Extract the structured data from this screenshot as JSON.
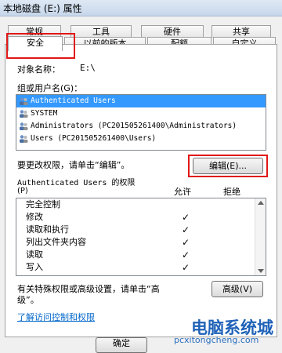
{
  "window": {
    "title": "本地磁盘 (E:) 属性"
  },
  "tabs_row1": [
    "常规",
    "工具",
    "硬件",
    "共享"
  ],
  "tabs_row2": [
    "安全",
    "以前的版本",
    "配额",
    "自定义"
  ],
  "object": {
    "label": "对象名称：",
    "value": "E:\\"
  },
  "group_list": {
    "label": "组或用户名(G)：",
    "items": [
      {
        "name": "Authenticated Users",
        "selected": true
      },
      {
        "name": "SYSTEM",
        "selected": false
      },
      {
        "name": "Administrators (PC201505261400\\Administrators)",
        "selected": false
      },
      {
        "name": "Users (PC201505261400\\Users)",
        "selected": false
      }
    ]
  },
  "edit": {
    "prompt": "要更改权限，请单击“编辑”。",
    "button": "编辑(E)..."
  },
  "permissions": {
    "title": "Authenticated Users 的权限",
    "title_key": "(P)",
    "allow_header": "允许",
    "deny_header": "拒绝",
    "rows": [
      {
        "name": "完全控制",
        "allow": ""
      },
      {
        "name": "修改",
        "allow": "✓"
      },
      {
        "name": "读取和执行",
        "allow": "✓"
      },
      {
        "name": "列出文件夹内容",
        "allow": "✓"
      },
      {
        "name": "读取",
        "allow": "✓"
      },
      {
        "name": "写入",
        "allow": "✓"
      }
    ]
  },
  "advanced": {
    "line1": "有关特殊权限或高级设置，请单击“高",
    "line2": "级”。",
    "button": "高级(V)"
  },
  "learn_link": "了解访问控制和权限",
  "footer": {
    "ok_button": "确定"
  },
  "watermark": {
    "title": "电脑系统城",
    "url": "pcxitongcheng.com"
  },
  "colors": {
    "highlight": "#e01818",
    "selection": "#3399ff",
    "link": "#0066cc"
  }
}
